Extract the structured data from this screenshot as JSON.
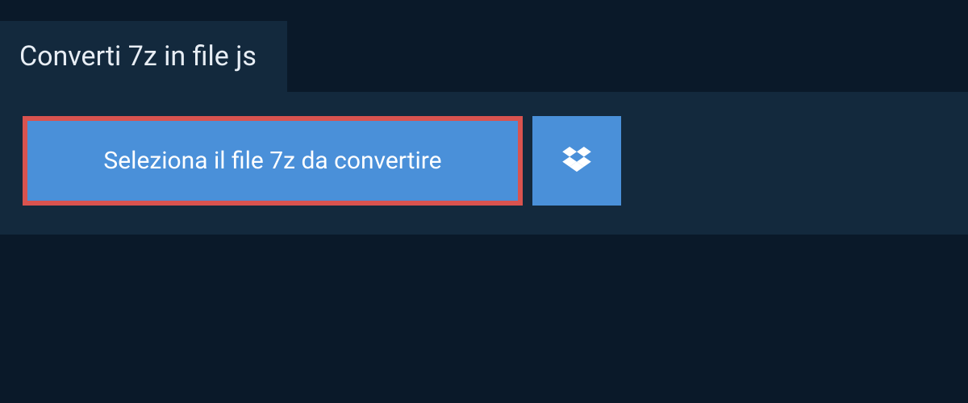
{
  "header": {
    "title": "Converti 7z in file js"
  },
  "actions": {
    "select_file_label": "Seleziona il file 7z da convertire"
  }
}
